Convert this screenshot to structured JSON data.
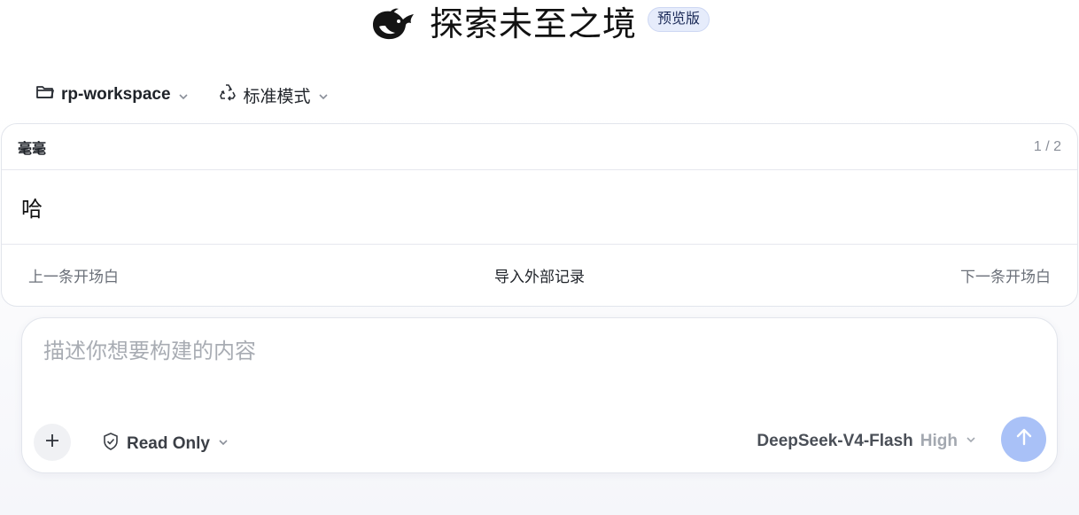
{
  "header": {
    "logo_icon": "whale-logo-icon",
    "title": "探索未至之境",
    "badge": "预览版"
  },
  "toolbar": {
    "workspace": {
      "icon": "folder-icon",
      "label": "rp-workspace"
    },
    "mode": {
      "icon": "recycle-icon",
      "label": "标准模式"
    }
  },
  "opening_card": {
    "character_name": "毫毫",
    "pager": "1 / 2",
    "message": "哈",
    "prev_label": "上一条开场白",
    "import_label": "导入外部记录",
    "next_label": "下一条开场白"
  },
  "composer": {
    "placeholder": "描述你想要构建的内容",
    "value": "",
    "attach_icon": "plus-icon",
    "access": {
      "icon": "shield-check-icon",
      "label": "Read Only"
    },
    "model": {
      "name": "DeepSeek-V4-Flash",
      "effort": "High"
    },
    "send_icon": "arrow-up-icon"
  },
  "colors": {
    "send_button": "#a9c1f7",
    "badge_bg": "#e6ecfb",
    "placeholder": "#a8acb3"
  }
}
